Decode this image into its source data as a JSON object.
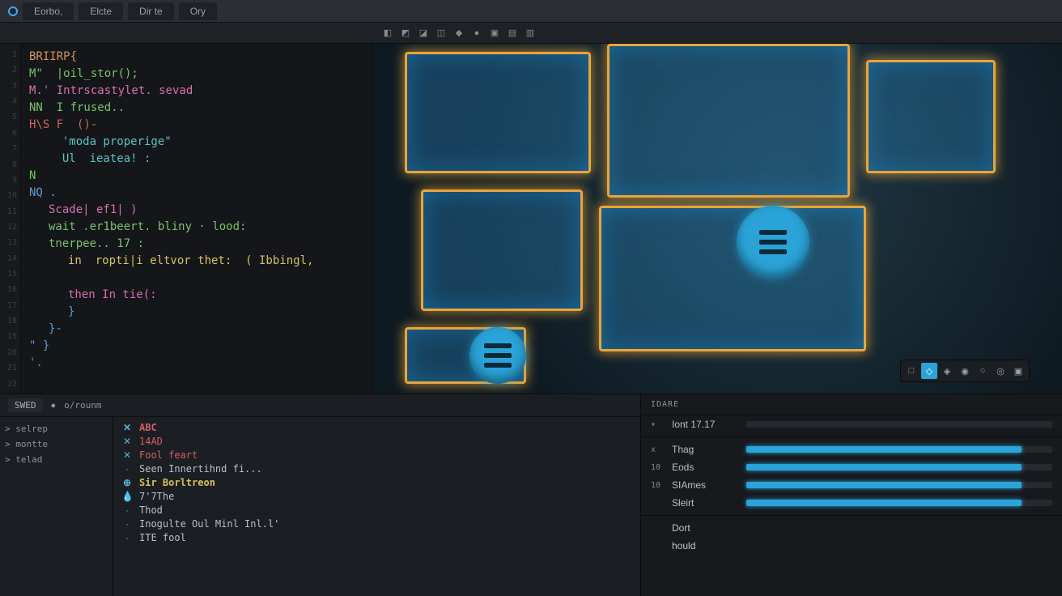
{
  "titlebar": {
    "tabs": [
      "Eorbo,",
      "Elcte",
      "Dir te",
      "Ory"
    ]
  },
  "toolbar_icons": [
    "◧",
    "◩",
    "◪",
    "◫",
    "◆",
    "●",
    "▣",
    "▤",
    "▥"
  ],
  "code": {
    "lines": [
      {
        "cls": "tok-or",
        "text": "BRIIRP{"
      },
      {
        "cls": "tok-gr",
        "text": "M\"  |oil_stor();"
      },
      {
        "cls": "tok-pk",
        "text": "M.' Intrscastylet. sevad"
      },
      {
        "cls": "tok-gr",
        "text": "NN  I frused.."
      },
      {
        "cls": "tok-rd",
        "text": "H\\S F  ()-"
      },
      {
        "cls": "tok-cy",
        "text": "  'moda properige\"",
        "ind": "ind1"
      },
      {
        "cls": "tok-cy",
        "text": "  Ul  ieatea! :",
        "ind": "ind1"
      },
      {
        "cls": "tok-gr",
        "text": "N"
      },
      {
        "cls": "tok-bl",
        "text": "NQ ."
      },
      {
        "cls": "tok-pk",
        "text": "Scade| ef1| )",
        "ind": "ind1"
      },
      {
        "cls": "tok-gr",
        "text": "wait .er1beert. bliny · lood:",
        "ind": "ind1"
      },
      {
        "cls": "tok-gr",
        "text": "tnerpee.. 17 :",
        "ind": "ind1"
      },
      {
        "cls": "tok-ye",
        "text": "in  ropti|i eltvor thet:  ( Ibbingl,",
        "ind": "ind2"
      },
      {
        "cls": "tok-wh",
        "text": ""
      },
      {
        "cls": "tok-pk",
        "text": "then In tie(:",
        "ind": "ind2"
      },
      {
        "cls": "tok-bl",
        "text": "}",
        "ind": "ind2"
      },
      {
        "cls": "tok-bl",
        "text": "}-",
        "ind": "ind1"
      },
      {
        "cls": "tok-bl",
        "text": "\" }"
      },
      {
        "cls": "tok-gy",
        "text": "'."
      }
    ]
  },
  "viewport_toolbar": [
    "□",
    "◇",
    "◈",
    "◉",
    "○",
    "◎",
    "▣"
  ],
  "assets": {
    "header": {
      "label": "SWED",
      "crumb": "o/rounm"
    },
    "tree": [
      "> selrep",
      "> montte",
      "> telad"
    ],
    "list": [
      {
        "icon": "✕",
        "cls": "close hdr",
        "label": "ABC"
      },
      {
        "icon": "✕",
        "cls": "close",
        "label": "14AD"
      },
      {
        "icon": "✕",
        "cls": "close",
        "label": "Fool feart"
      },
      {
        "icon": "·",
        "cls": "",
        "label": "Seen Innertihnd fi..."
      },
      {
        "icon": "⊕",
        "cls": "hdr",
        "label": "Sir Borltreon"
      },
      {
        "icon": "💧",
        "cls": "",
        "label": "7'7The"
      },
      {
        "icon": "·",
        "cls": "",
        "label": "Thod"
      },
      {
        "icon": "·",
        "cls": "",
        "label": "Inogulte  Oul  Minl  Inl.l'"
      },
      {
        "icon": "·",
        "cls": "",
        "label": "ITE fool"
      }
    ]
  },
  "panel": {
    "header": "IDARE",
    "title_row": {
      "label": "Iont  17.17"
    },
    "tracks": [
      {
        "key": "x",
        "label": "Thag",
        "filled": true
      },
      {
        "key": "10",
        "label": "Eods",
        "filled": true
      },
      {
        "key": "10",
        "label": "SIAmes",
        "filled": true
      },
      {
        "key": "",
        "label": "Sleirt",
        "filled": true
      }
    ],
    "sub": [
      {
        "key": "·",
        "label": "Dort"
      },
      {
        "key": "·",
        "label": "hould"
      }
    ]
  }
}
